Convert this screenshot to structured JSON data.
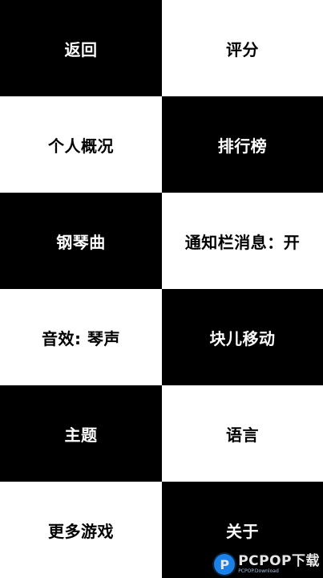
{
  "menu": {
    "back": "返回",
    "rate": "评分",
    "profile": "个人概况",
    "leaderboard": "排行榜",
    "piano_songs": "钢琴曲",
    "notification": "通知栏消息：开",
    "sound_effect": "音效: 琴声",
    "block_move": "块儿移动",
    "theme": "主题",
    "language": "语言",
    "more_games": "更多游戏",
    "about": "关于"
  },
  "watermark": {
    "logo_letter": "P",
    "brand": "PCPOP下载",
    "sub": "PCPOP.Download"
  },
  "colors": {
    "dark_tile": "#000000",
    "light_tile": "#ffffff",
    "watermark_blue": "#1e90ff"
  }
}
